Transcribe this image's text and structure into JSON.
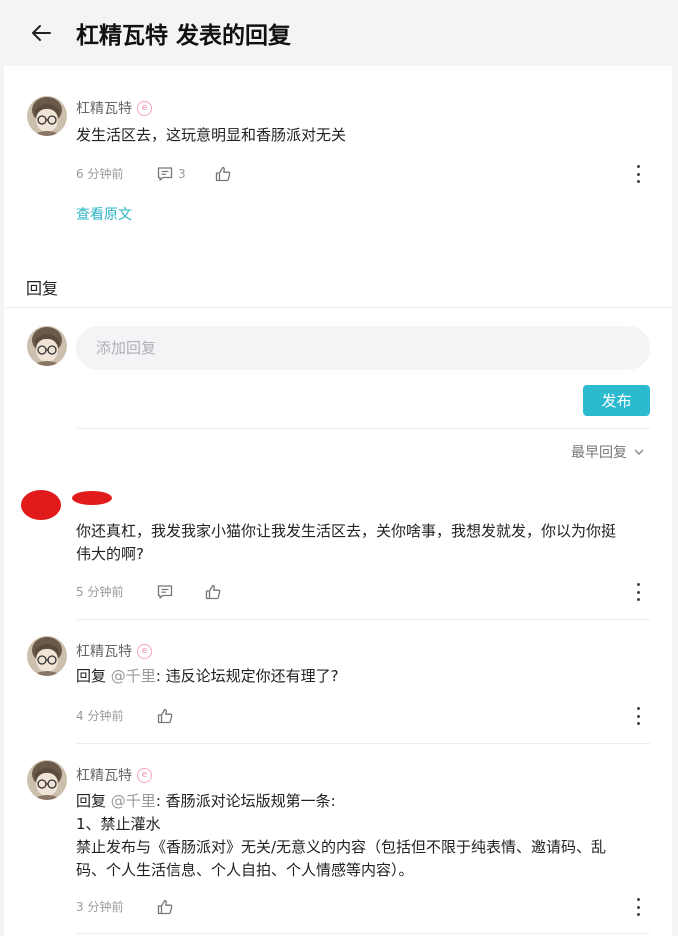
{
  "header": {
    "title": "杠精瓦特 发表的回复"
  },
  "original": {
    "username": "杠精瓦特",
    "text": "发生活区去，这玩意明显和香肠派对无关",
    "time": "6 分钟前",
    "comment_count": "3",
    "view_original": "查看原文"
  },
  "replies_section": {
    "title": "回复"
  },
  "composer": {
    "placeholder": "添加回复",
    "submit": "发布"
  },
  "sort": {
    "label": "最早回复"
  },
  "replies": [
    {
      "username": "",
      "text": "你还真杠，我发我家小猫你让我发生活区去，关你啥事，我想发就发，你以为你挺\n伟大的啊?",
      "time": "5 分钟前"
    },
    {
      "username": "杠精瓦特",
      "reply_prefix": "回复",
      "mention": "@千里",
      "text": ": 违反论坛规定你还有理了?",
      "time": "4 分钟前"
    },
    {
      "username": "杠精瓦特",
      "reply_prefix": "回复",
      "mention": "@千里",
      "text": ": 香肠派对论坛版规第一条:\n1、禁止灌水\n禁止发布与《香肠派对》无关/无意义的内容（包括但不限于纯表情、邀请码、乱\n码、个人生活信息、个人自拍、个人情感等内容）。",
      "time": "3 分钟前"
    }
  ],
  "colors": {
    "accent": "#2bbace",
    "badge": "#f28ab0",
    "redaction": "#e11b1b"
  },
  "icons": [
    "back-arrow-icon",
    "comment-icon",
    "thumbs-up-icon",
    "more-icon",
    "chevron-down-icon",
    "user-badge-icon"
  ]
}
